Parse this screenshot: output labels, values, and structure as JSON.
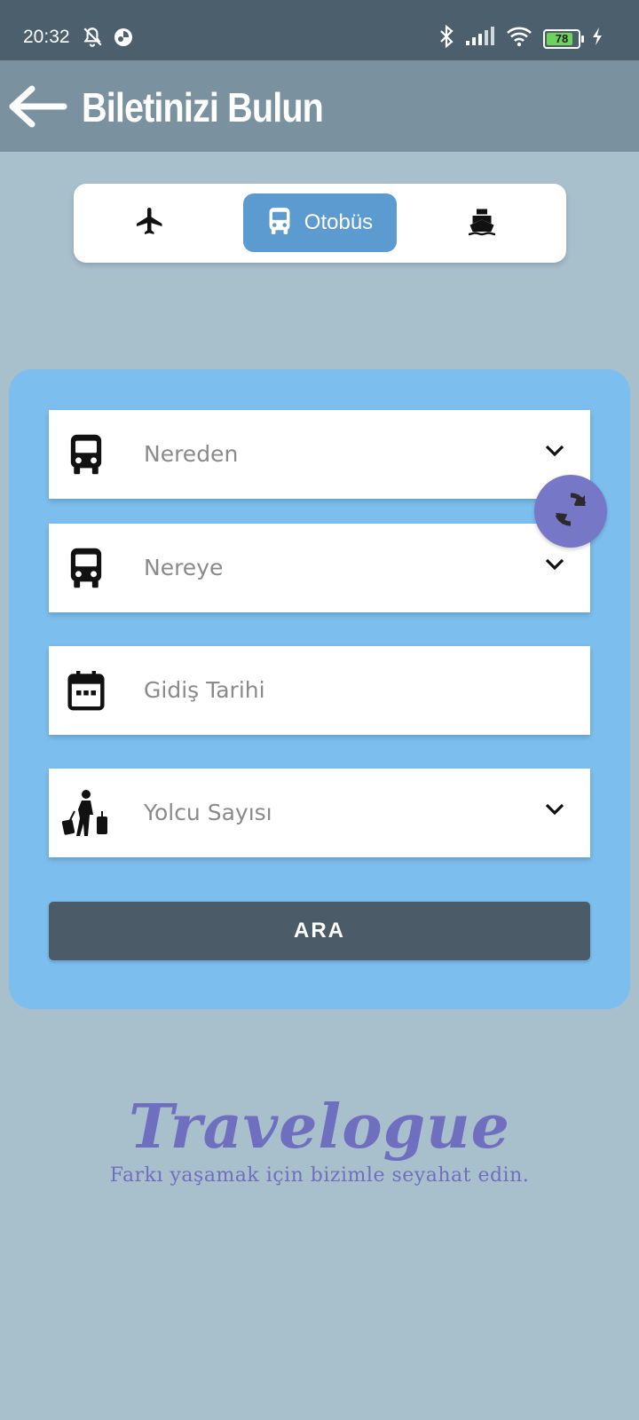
{
  "status_bar": {
    "time": "20:32",
    "battery_level": "78",
    "icons": [
      "alarm-off-icon",
      "app-notification-icon",
      "bluetooth-icon",
      "signal-icon",
      "wifi-icon",
      "battery-icon",
      "charging-icon"
    ]
  },
  "app_bar": {
    "title": "Biletinizi Bulun",
    "back_icon": "arrow-left-icon"
  },
  "transport_modes": [
    {
      "icon": "plane-icon",
      "label": "",
      "selected": false
    },
    {
      "icon": "bus-icon",
      "label": "Otobüs",
      "selected": true
    },
    {
      "icon": "ship-icon",
      "label": "",
      "selected": false
    }
  ],
  "form": {
    "from": {
      "placeholder": "Nereden",
      "icon": "bus-icon"
    },
    "to": {
      "placeholder": "Nereye",
      "icon": "bus-icon"
    },
    "date": {
      "placeholder": "Gidiş Tarihi",
      "icon": "calendar-icon"
    },
    "passengers": {
      "placeholder": "Yolcu Sayısı",
      "icon": "traveler-luggage-icon"
    },
    "swap_icon": "swap-icon",
    "search_label": "ARA"
  },
  "branding": {
    "name": "Travelogue",
    "tagline": "Farkı yaşamak için bizimle seyahat edin."
  },
  "colors": {
    "background": "#a8bfcc",
    "app_bar": "#7a929f",
    "status_bar": "#4b5f6c",
    "selected_tab": "#5b9bcf",
    "form_card": "#7cbfef",
    "swap_button": "#7777c8",
    "search_button": "#4b5b67",
    "brand": "#6f6fc0"
  }
}
